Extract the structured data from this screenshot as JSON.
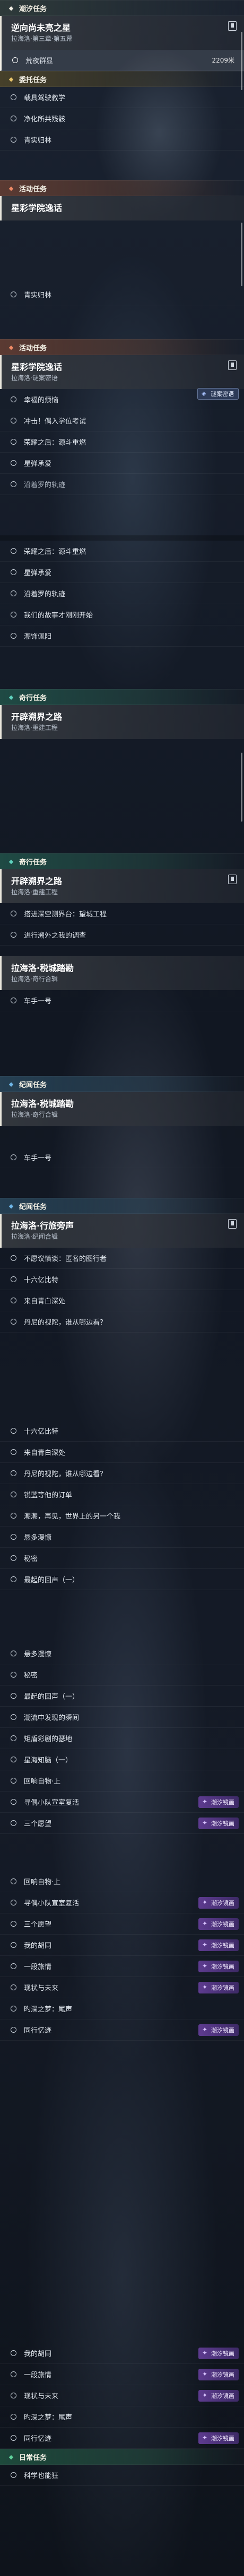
{
  "s1": {
    "header_ongoing": "潮汐任务",
    "tracked": {
      "title": "逆向尚未亮之星",
      "sub": "拉海洛·第三章·第五幕"
    },
    "selected": {
      "label": "荒夜群显",
      "distance": "2209米"
    },
    "header_errand": "委托任务",
    "errands": [
      "载具驾驶教学",
      "净化所共残骸",
      "青实归林"
    ]
  },
  "s2": {
    "header_activity": "活动任务",
    "tracked": {
      "title": "星彩学院逸话",
      "sub": ""
    },
    "items": [
      "青实归林"
    ]
  },
  "s3": {
    "header_activity": "活动任务",
    "tracked": {
      "title": "星彩学院逸话",
      "sub": "拉海洛·谜案密语"
    },
    "float_badge": "谜案密语",
    "items": [
      "幸福的烦恼",
      "冲击！偶入学位考试",
      "荣耀之后：源斗重燃",
      "星弹承爱",
      "沿着罗的轨迹"
    ]
  },
  "s4": {
    "items": [
      "荣耀之后：源斗重燃",
      "星弹承爱",
      "沿着罗的轨迹",
      "我们的故事才刚刚开始",
      "潮饰佩阳"
    ]
  },
  "s5": {
    "header_story": "奇行任务",
    "tracked": {
      "title": "开辟溯界之路",
      "sub": "拉海洛·重建工程"
    }
  },
  "s6": {
    "header_story": "奇行任务",
    "tracked": {
      "title": "开辟溯界之路",
      "sub": "拉海洛·重建工程"
    },
    "items": [
      "搭进深空测界台：望城工程",
      "进行溯外之我的调查"
    ],
    "tracked2": {
      "title": "拉海洛·税城踏勘",
      "sub": "拉海洛·奇行合辑"
    },
    "items2": [
      "车手一号"
    ]
  },
  "s7": {
    "header_bond": "纪闻任务",
    "tracked": {
      "title": "拉海洛·税城踏勘",
      "sub": "拉海洛·奇行合辑"
    },
    "items": [
      "车手一号"
    ]
  },
  "s8": {
    "header_bond": "纪闻任务",
    "tracked": {
      "title": "拉海洛·行旅旁声",
      "sub": "拉海洛·纪闻合辑"
    },
    "items": [
      "不愿议慎谈：匿名的图行者",
      "十六亿比特",
      "来自青白深处",
      "丹尼的视陀，谁从哪边看？"
    ]
  },
  "s9": {
    "items": [
      "十六亿比特",
      "来自青白深处",
      "丹尼的视陀，谁从哪边看？",
      "锐蓝等他的订单",
      "潮潮，再见，世界上的另一个我",
      "悬多漫慷",
      "秘密",
      "最起的回声（一）"
    ]
  },
  "s10": {
    "items": [
      "悬多漫慷",
      "秘密",
      "最起的回声（一）",
      "潮流中发现的瞬间",
      "矩盾彩剧的瑟地",
      "星海知脑（一）",
      "回响自物·上",
      "寻偶小队宣室复活",
      "三个愿望"
    ],
    "badges": {
      "寻偶小队宣室复活": "潮汐镜画",
      "三个愿望": "潮汐镜画"
    }
  },
  "s11": {
    "items": [
      "回响自物·上",
      "寻偶小队宣室复活",
      "三个愿望",
      "我的胡同",
      "一段旅情",
      "现状与未来",
      "旳深之梦：尾声",
      "同行忆迹"
    ],
    "badges": {
      "寻偶小队宣室复活": "潮汐镜画",
      "三个愿望": "潮汐镜画",
      "我的胡同": "潮汐镜画",
      "一段旅情": "潮汐镜画",
      "现状与未来": "潮汐镜画",
      "同行忆迹": "潮汐镜画"
    }
  },
  "s12": {
    "items": [
      "我的胡同",
      "一段旅情",
      "现状与未来",
      "旳深之梦：尾声",
      "同行忆迹"
    ],
    "badges": {
      "我的胡同": "潮汐镜画",
      "一段旅情": "潮汐镜画",
      "现状与未来": "潮汐镜画",
      "同行忆迹": "潮汐镜画"
    },
    "header_daily": "日常任务",
    "daily": [
      "科学也能狂"
    ]
  }
}
